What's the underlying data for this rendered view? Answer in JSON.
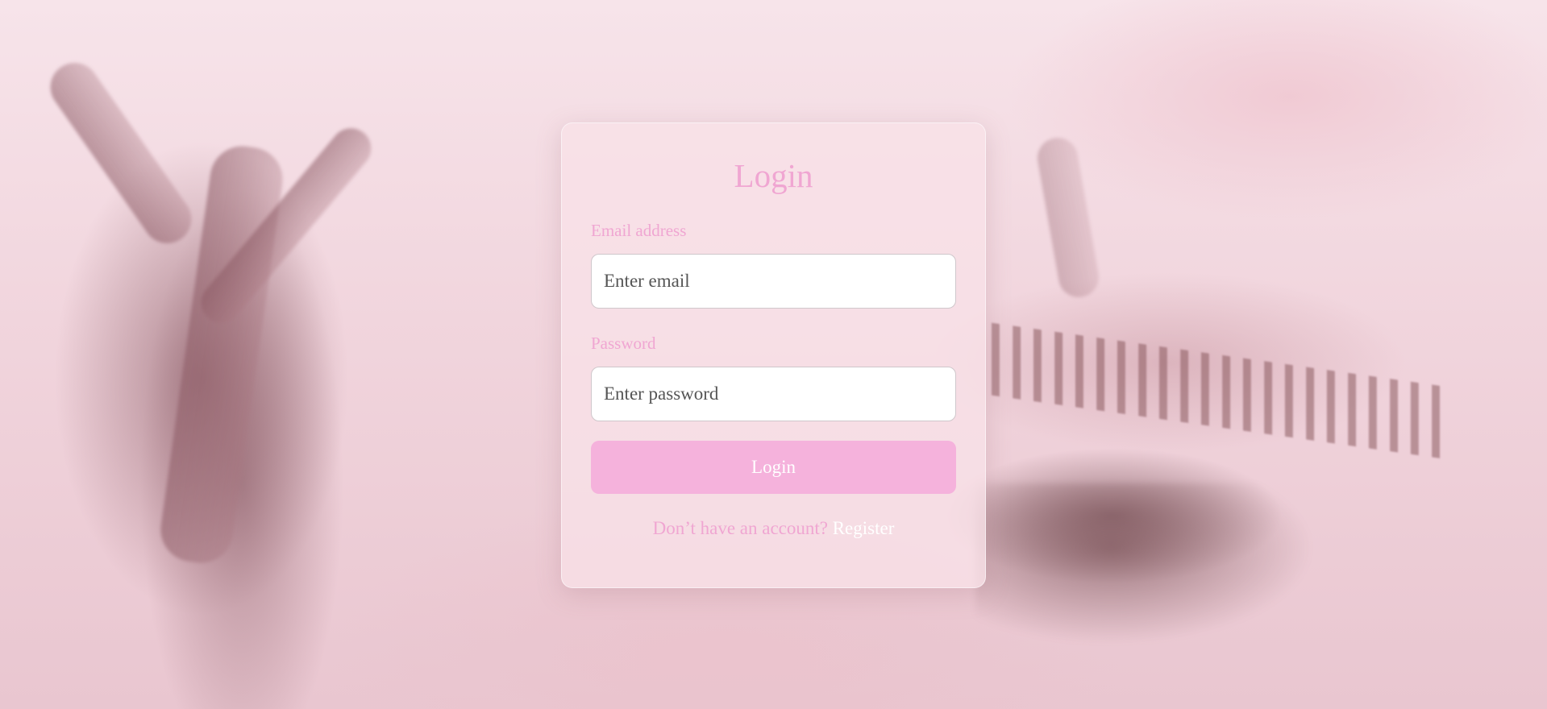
{
  "login_form": {
    "title": "Login",
    "email": {
      "label": "Email address",
      "placeholder": "Enter email",
      "value": ""
    },
    "password": {
      "label": "Password",
      "placeholder": "Enter password",
      "value": ""
    },
    "submit_label": "Login",
    "footer": {
      "prompt": "Don’t have an account?",
      "link_label": "Register"
    }
  },
  "colors": {
    "accent_pink": "#f0a6d2",
    "button_pink": "#f5b2dc",
    "card_background": "#f8e2e8",
    "link_white": "#ffffff"
  },
  "background": {
    "icon": "cherry-blossom-scene"
  }
}
